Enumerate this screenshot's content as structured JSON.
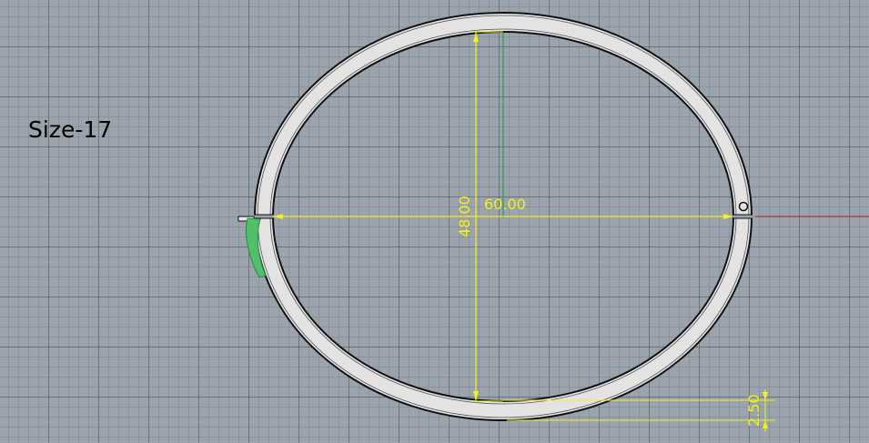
{
  "size_label": "Size-17",
  "dimensions": {
    "width": "60.00",
    "height": "48.00",
    "thickness": "2.50"
  },
  "colors": {
    "viewport_background": "#9ba3ad",
    "dimension": "#f2f218",
    "axis_y": "#2e9e3a",
    "axis_x": "#b23a3a",
    "ring_fill": "#e3e3e3",
    "highlight": "#4fbf6a"
  }
}
